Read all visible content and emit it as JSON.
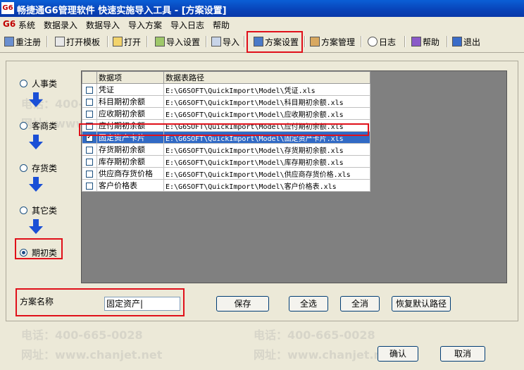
{
  "window": {
    "title": "畅捷通G6管理软件 快速实施导入工具 - [方案设置]",
    "logo": "G6"
  },
  "menu": {
    "brand": "G6",
    "items": [
      "系统",
      "数据录入",
      "数据导入",
      "导入方案",
      "导入日志",
      "帮助"
    ]
  },
  "toolbar": {
    "buttons": [
      "重注册",
      "打开模板",
      "打开",
      "导入设置",
      "导入",
      "方案设置",
      "方案管理",
      "日志",
      "帮助",
      "退出"
    ]
  },
  "categories": [
    {
      "label": "人事类",
      "selected": false
    },
    {
      "label": "客商类",
      "selected": false
    },
    {
      "label": "存货类",
      "selected": false
    },
    {
      "label": "其它类",
      "selected": false
    },
    {
      "label": "期初类",
      "selected": true
    }
  ],
  "grid": {
    "headers": [
      "数据项",
      "数据表路径"
    ],
    "rows": [
      {
        "checked": false,
        "name": "凭证",
        "path": "E:\\G6SOFT\\QuickImport\\Model\\凭证.xls",
        "selected": false
      },
      {
        "checked": false,
        "name": "科目期初余额",
        "path": "E:\\G6SOFT\\QuickImport\\Model\\科目期初余额.xls",
        "selected": false
      },
      {
        "checked": false,
        "name": "应收期初余额",
        "path": "E:\\G6SOFT\\QuickImport\\Model\\应收期初余额.xls",
        "selected": false
      },
      {
        "checked": false,
        "name": "应付期初余额",
        "path": "E:\\G6SOFT\\QuickImport\\Model\\应付期初余额.xls",
        "selected": false
      },
      {
        "checked": true,
        "name": "固定资产卡片",
        "path": "E:\\G6SOFT\\QuickImport\\Model\\固定资产卡片.xls",
        "selected": true
      },
      {
        "checked": false,
        "name": "存货期初余额",
        "path": "E:\\G6SOFT\\QuickImport\\Model\\存货期初余额.xls",
        "selected": false
      },
      {
        "checked": false,
        "name": "库存期初余额",
        "path": "E:\\G6SOFT\\QuickImport\\Model\\库存期初余额.xls",
        "selected": false
      },
      {
        "checked": false,
        "name": "供应商存货价格",
        "path": "E:\\G6SOFT\\QuickImport\\Model\\供应商存货价格.xls",
        "selected": false
      },
      {
        "checked": false,
        "name": "客户价格表",
        "path": "E:\\G6SOFT\\QuickImport\\Model\\客户价格表.xls",
        "selected": false
      }
    ]
  },
  "scheme": {
    "label": "方案名称",
    "value": "固定资产|"
  },
  "actions": {
    "save": "保存",
    "select_all": "全选",
    "deselect_all": "全消",
    "restore": "恢复默认路径",
    "ok": "确认",
    "cancel": "取消"
  },
  "watermark": {
    "phone": "电话：400-665-0028",
    "site": "网址：www.chanjet.net"
  },
  "colors": {
    "highlight": "#e0101a",
    "selection": "#316ac5",
    "arrow": "#1a4fd6"
  }
}
